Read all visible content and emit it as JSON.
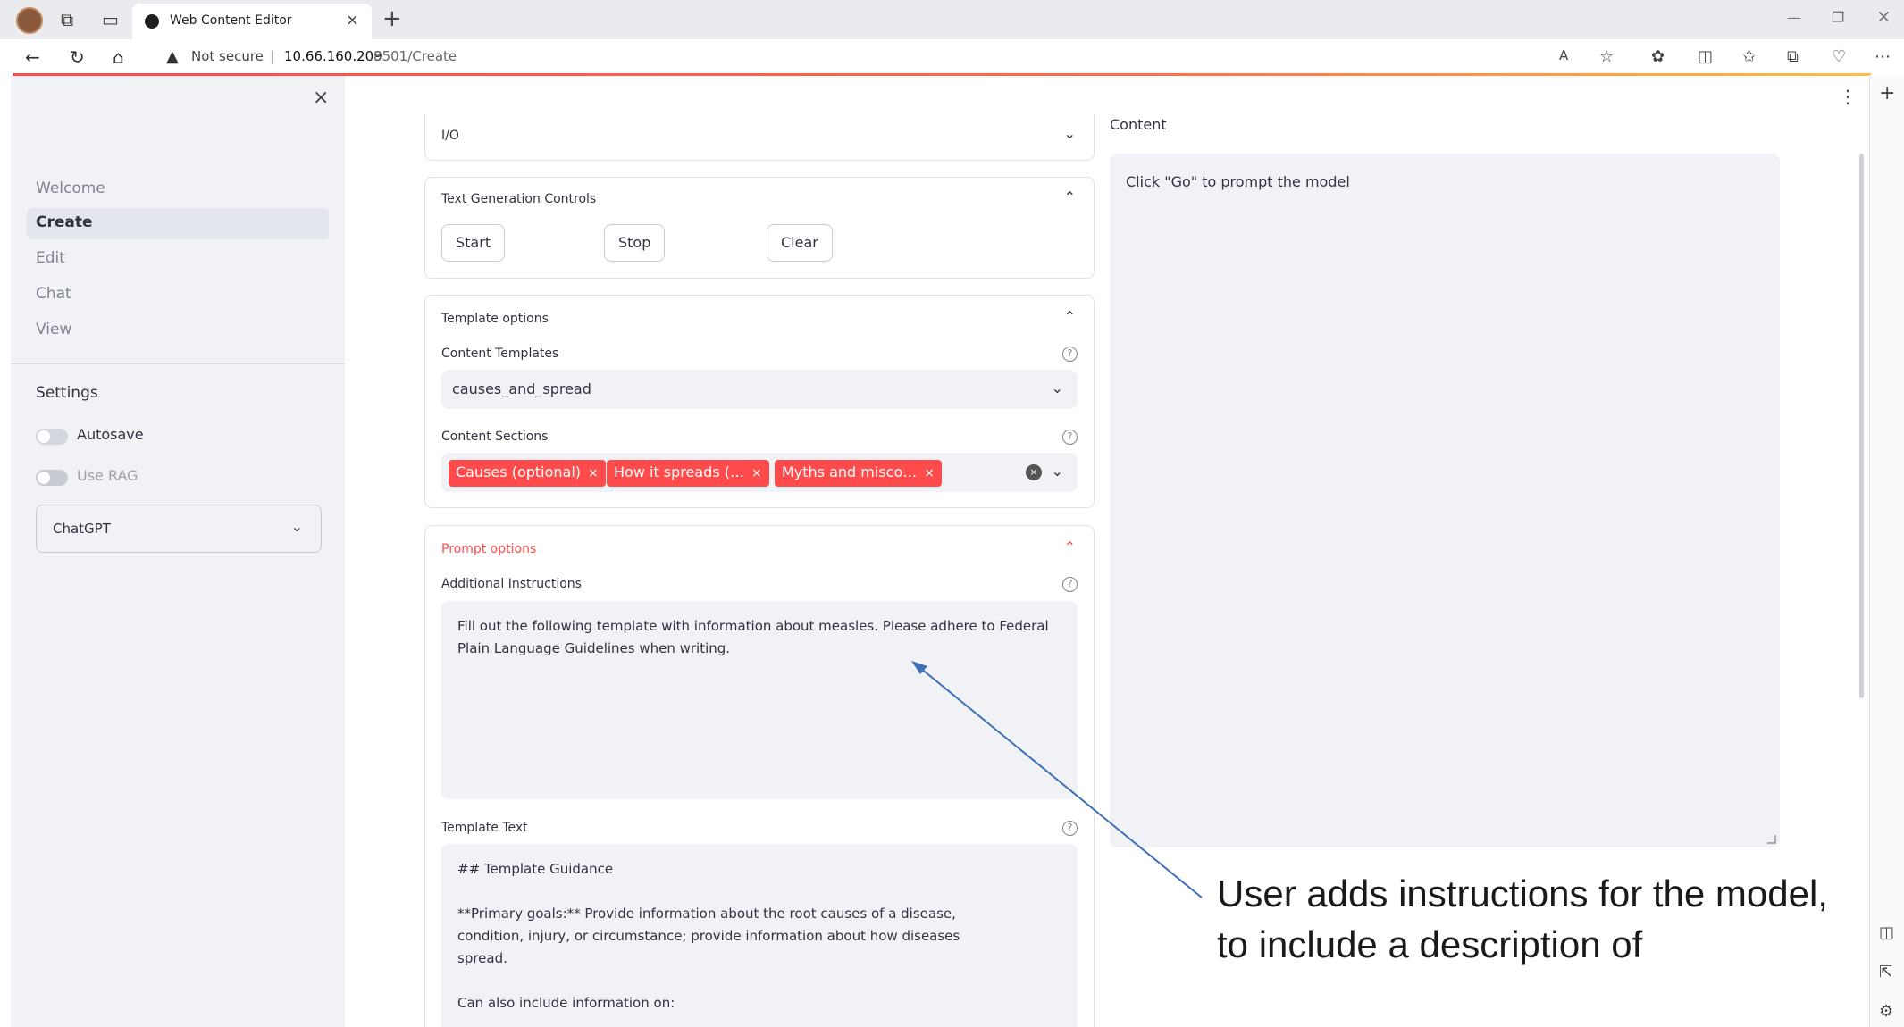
{
  "browser": {
    "tab_title": "Web Content Editor",
    "not_secure": "Not secure",
    "url_host": "10.66.160.209",
    "url_rest": ":8501/Create"
  },
  "sidebar": {
    "nav": [
      {
        "label": "Welcome",
        "active": false
      },
      {
        "label": "Create",
        "active": true
      },
      {
        "label": "Edit",
        "active": false
      },
      {
        "label": "Chat",
        "active": false
      },
      {
        "label": "View",
        "active": false
      }
    ],
    "settings_title": "Settings",
    "autosave_label": "Autosave",
    "use_rag_label": "Use RAG",
    "model_value": "ChatGPT"
  },
  "main": {
    "io_title": "I/O",
    "textgen": {
      "title": "Text Generation Controls",
      "start": "Start",
      "stop": "Stop",
      "clear": "Clear"
    },
    "template_options": {
      "title": "Template options",
      "content_templates_label": "Content Templates",
      "content_templates_value": "causes_and_spread",
      "content_sections_label": "Content Sections",
      "chips": [
        "Causes (optional)",
        "How it spreads (…",
        "Myths and misco…"
      ]
    },
    "prompt_options": {
      "title": "Prompt options",
      "additional_label": "Additional Instructions",
      "additional_value": "Fill out the following template with information about measles. Please adhere to Federal Plain Language Guidelines when writing.",
      "template_text_label": "Template Text",
      "template_lines": [
        "## Template Guidance",
        "**Primary goals:** Provide information about the root causes of a disease, condition, injury, or circumstance; provide information about how diseases spread.",
        "Can also include information on:"
      ]
    },
    "content_label": "Content",
    "content_placeholder": "Click \"Go\" to prompt the model"
  },
  "annotation": {
    "text": "User adds instructions for the model, to include a description of"
  },
  "colors": {
    "accent": "#ff4b4b",
    "sidebar_bg": "#f0f2f6",
    "arrow": "#3f6fb5"
  }
}
